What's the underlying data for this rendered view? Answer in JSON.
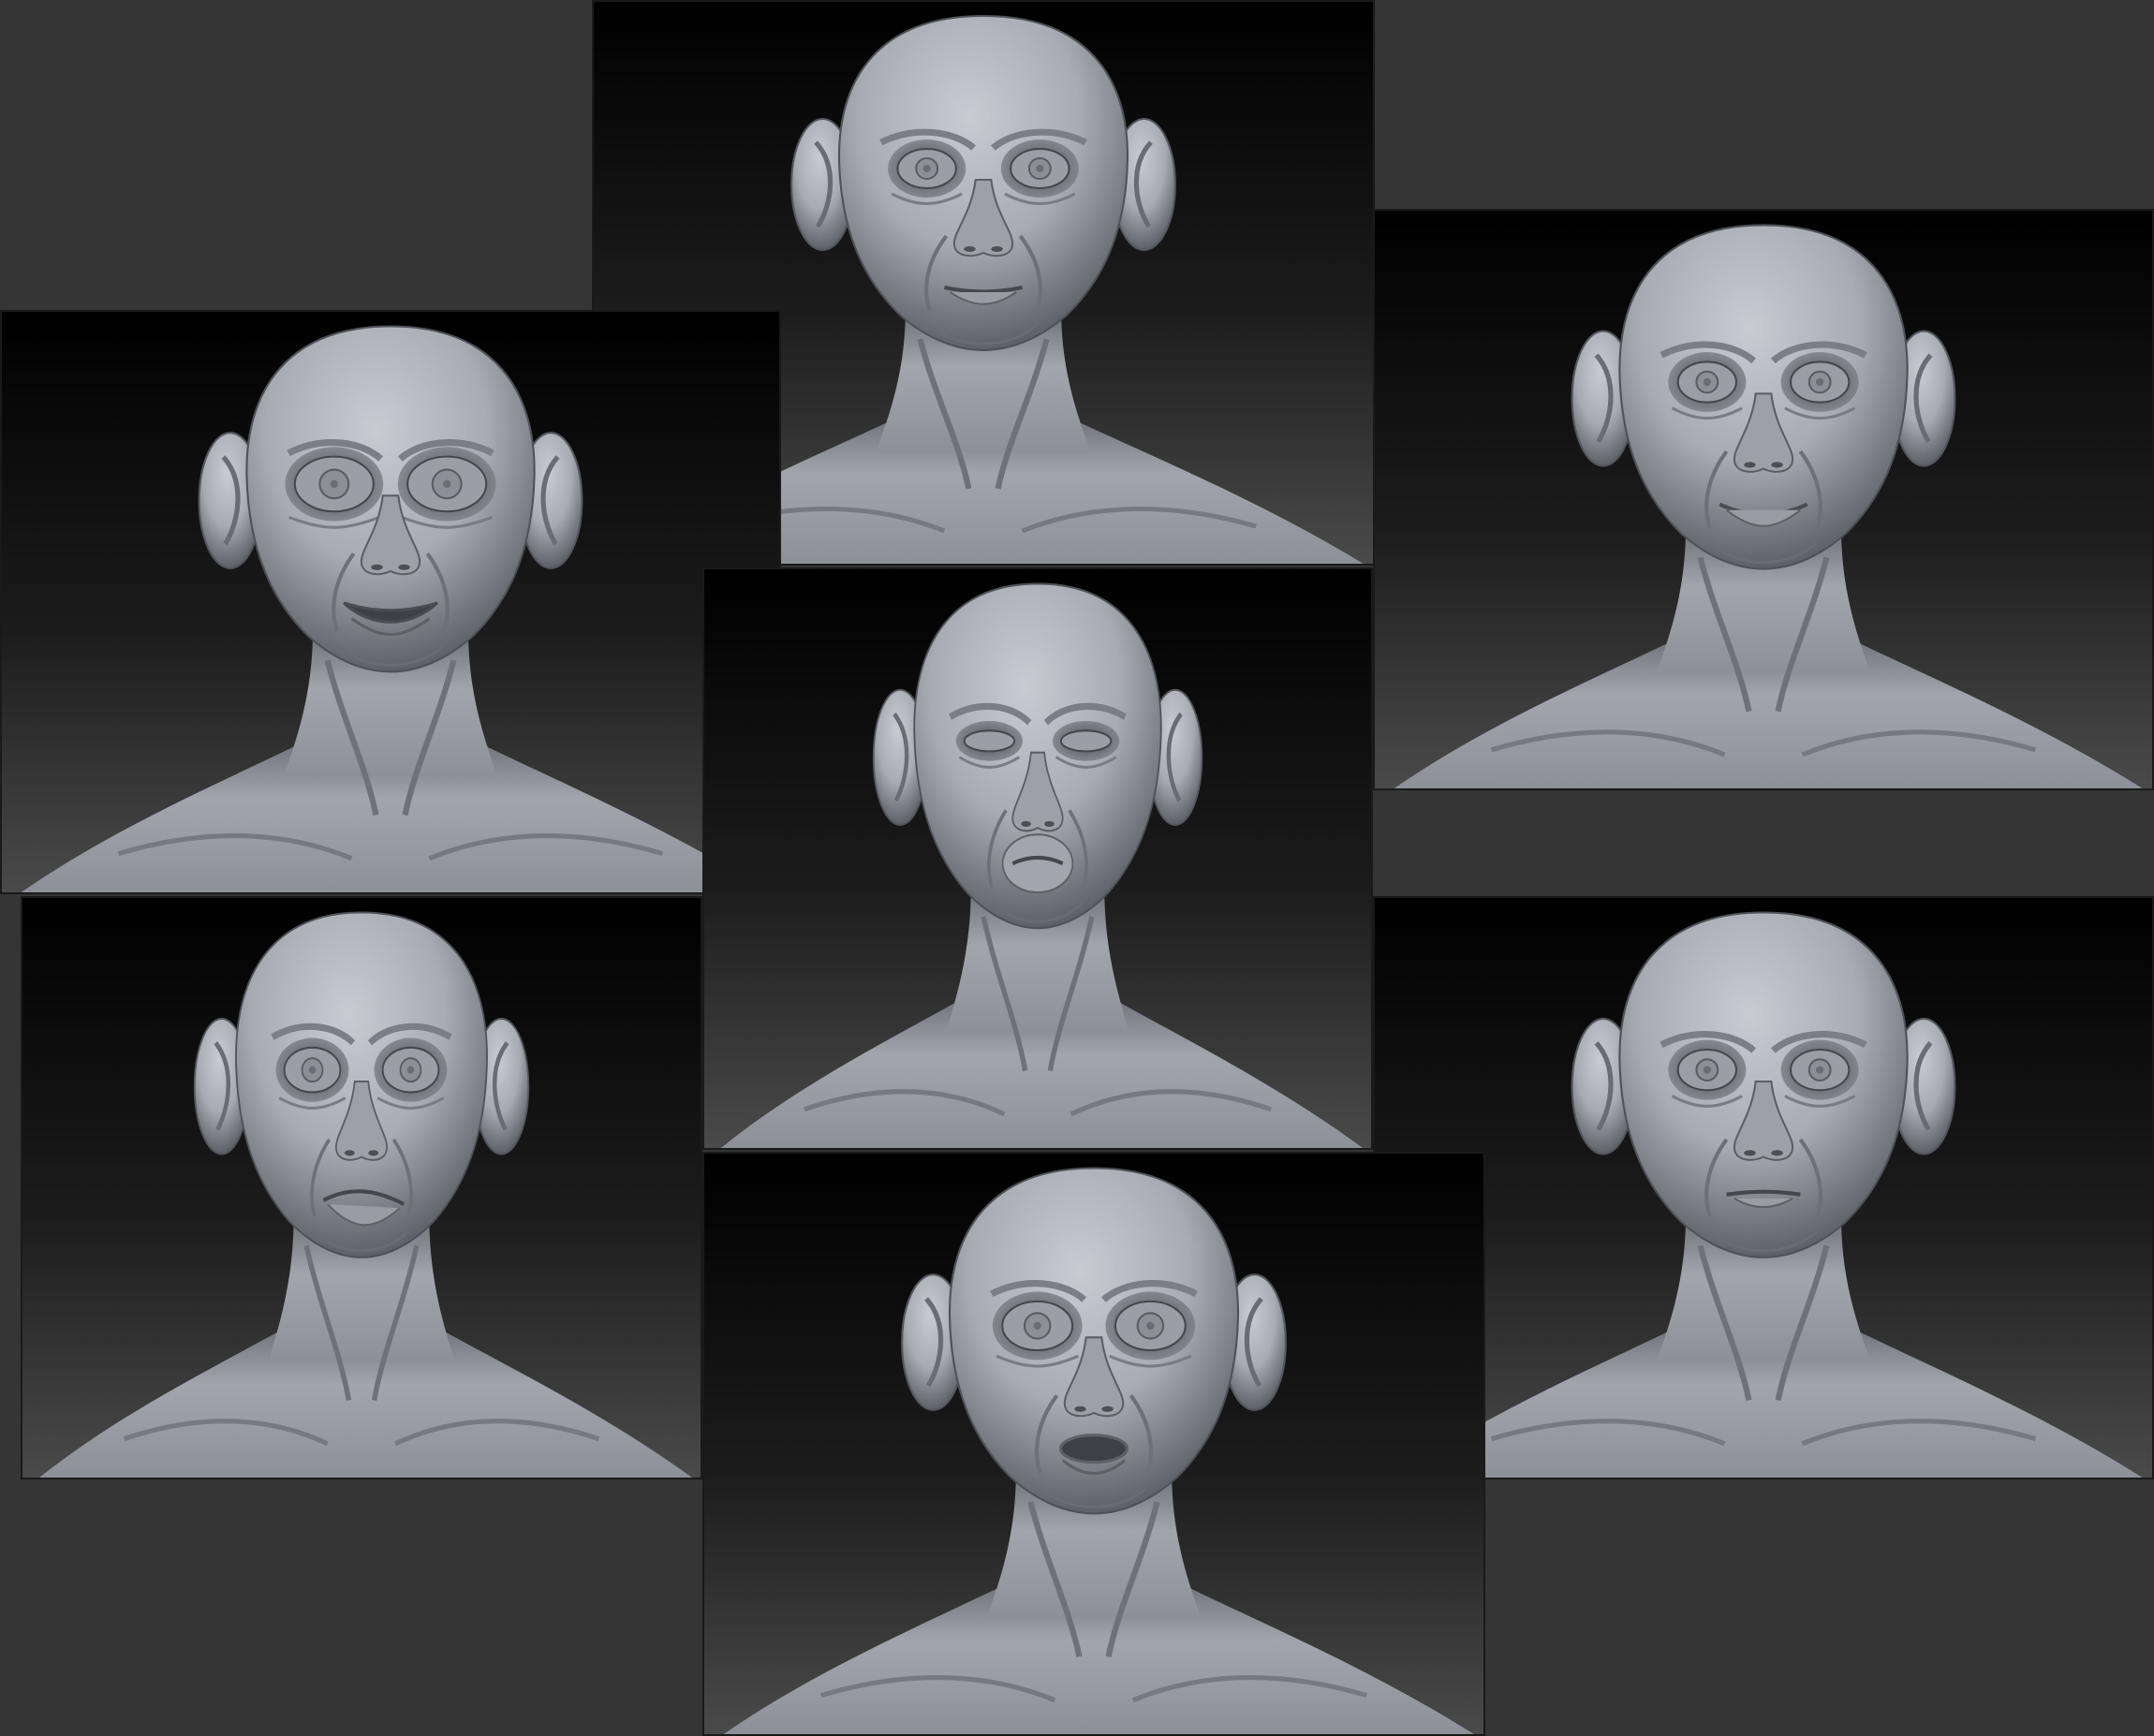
{
  "document": {
    "kind": "sculpt-render-collage",
    "background_color": "#353535",
    "render_background_top": "#000000",
    "render_background_bottom": "#4a4a4a",
    "clay_color": "#a9abb3"
  },
  "panels": [
    {
      "id": "top-center",
      "expression": "neutral"
    },
    {
      "id": "right-top",
      "expression": "slight-smile"
    },
    {
      "id": "left-top",
      "expression": "wide-eyed-smile"
    },
    {
      "id": "center-middle",
      "expression": "squint-pucker"
    },
    {
      "id": "right-bottom",
      "expression": "pursed-neutral"
    },
    {
      "id": "left-bottom",
      "expression": "frown-asymmetric"
    },
    {
      "id": "center-bottom",
      "expression": "surprised-o-mouth"
    }
  ]
}
